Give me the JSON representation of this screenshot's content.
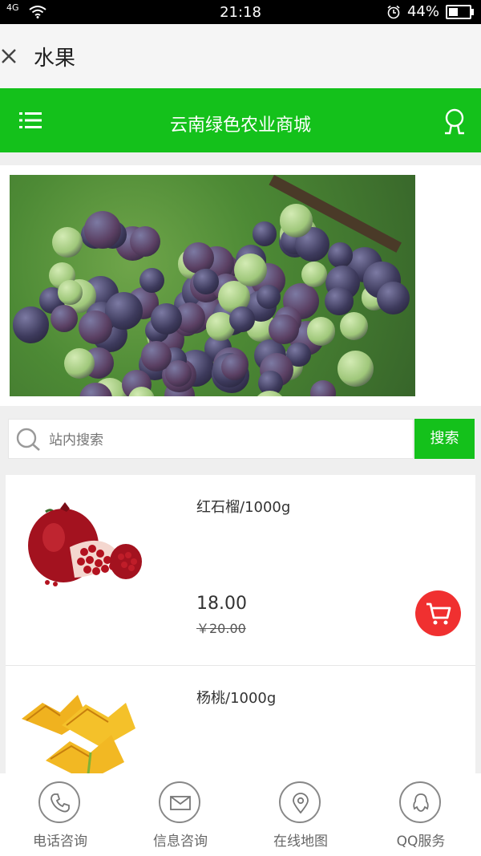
{
  "status_bar": {
    "network": "4G",
    "time": "21:18",
    "battery": "44%",
    "battery_level": 0.44
  },
  "header": {
    "title": "水果"
  },
  "store_bar": {
    "store_name": "云南绿色农业商城"
  },
  "search": {
    "placeholder": "站内搜索",
    "button_label": "搜索"
  },
  "products": [
    {
      "name": "红石榴/1000g",
      "price": "18.00",
      "original_price": "￥20.00"
    },
    {
      "name": "杨桃/1000g"
    }
  ],
  "bottom_nav": [
    {
      "label": "电话咨询",
      "icon": "phone-icon"
    },
    {
      "label": "信息咨询",
      "icon": "mail-icon"
    },
    {
      "label": "在线地图",
      "icon": "location-pin-icon"
    },
    {
      "label": "QQ服务",
      "icon": "qq-icon"
    }
  ],
  "colors": {
    "brand_green": "#14c11b",
    "cart_red": "#f03030"
  }
}
